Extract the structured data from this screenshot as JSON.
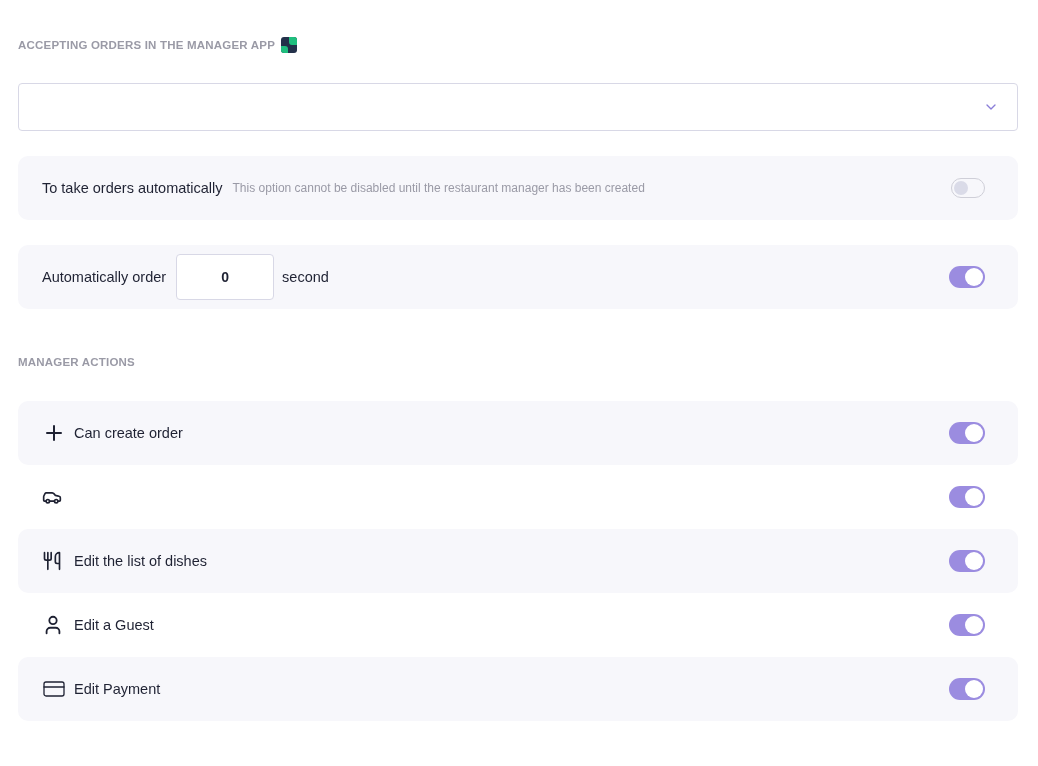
{
  "accepting": {
    "title": "ACCEPTING ORDERS IN THE MANAGER APP",
    "auto_take": {
      "label": "To take orders automatically",
      "hint": "This option cannot be disabled until the restaurant manager has been created",
      "on": false,
      "disabled": true
    },
    "auto_order": {
      "label": "Automatically order",
      "value": "0",
      "unit": "second",
      "on": true
    }
  },
  "actions": {
    "title": "MANAGER ACTIONS",
    "items": [
      {
        "kind": "plus",
        "label": "Can create order",
        "on": true
      },
      {
        "kind": "car",
        "on": true
      },
      {
        "kind": "utensils",
        "label": "Edit the list of dishes",
        "on": true
      },
      {
        "kind": "user",
        "label": "Edit a Guest",
        "on": true
      },
      {
        "kind": "card",
        "label": "Edit Payment",
        "on": true
      }
    ]
  }
}
